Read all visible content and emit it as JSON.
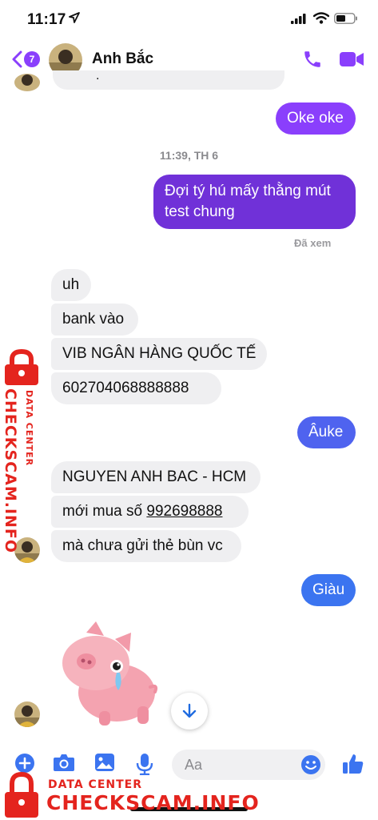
{
  "status_bar": {
    "time": "11:17"
  },
  "header": {
    "back_badge": "7",
    "contact_name": "Anh Bắc"
  },
  "messages": {
    "prev_fragment": ".",
    "m1": "Oke oke",
    "timestamp": "11:39, TH 6",
    "m2_line1": "Đợi tý hú mấy thằng mút",
    "m2_line2": "test chung",
    "seen": "Đã xem",
    "m3": "uh",
    "m4": "bank vào",
    "m5": "VIB NGÂN HÀNG QUỐC TẾ",
    "m6": "602704068888888",
    "m7": "Âuke",
    "m8": "NGUYEN ANH BAC - HCM",
    "m9_prefix": "mới mua số ",
    "m9_number": "992698888",
    "m10": "mà chưa gửi thẻ bùn vc",
    "m11": "Giàu"
  },
  "composer": {
    "placeholder": "Aa"
  },
  "watermark": {
    "main": "CHECKSCAM.INFO",
    "sub": "DATA CENTER"
  },
  "colors": {
    "accent": "#8a3ffc",
    "outgoing_purple": "#7b3ff2",
    "outgoing_blue": "#4a6bf0",
    "incoming": "#efeff1",
    "watermark": "#e4241e"
  }
}
